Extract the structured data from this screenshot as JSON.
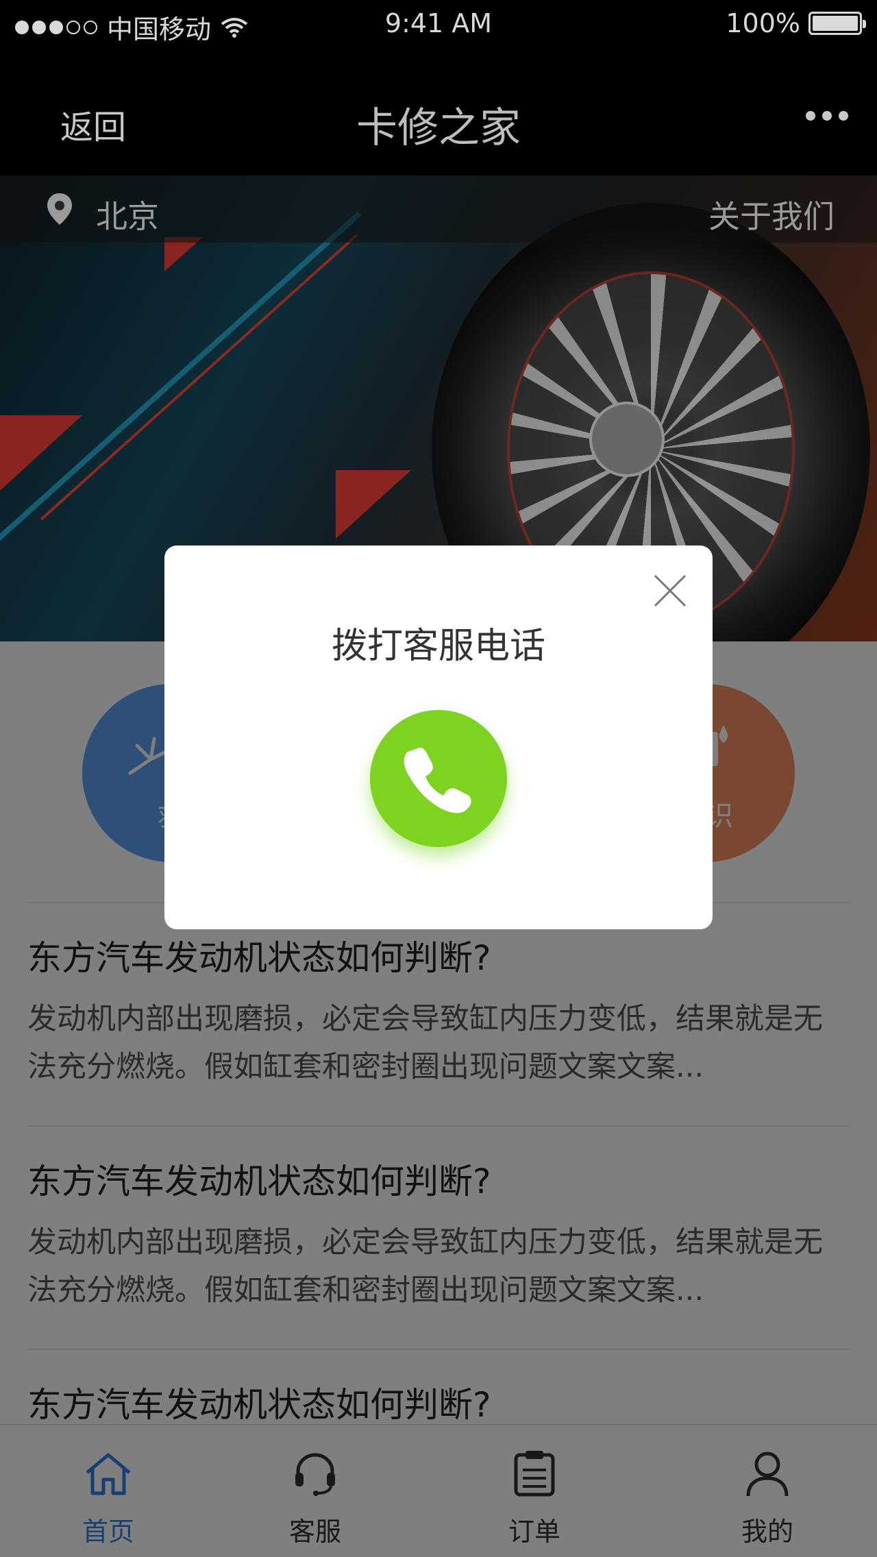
{
  "status_bar": {
    "carrier": "中国移动",
    "time": "9:41 AM",
    "battery": "100%"
  },
  "nav": {
    "back_label": "返回",
    "title": "卡修之家"
  },
  "banner": {
    "city": "北京",
    "about_label": "关于我们"
  },
  "shortcuts": [
    {
      "label": "救",
      "color": "#5d9ff0"
    },
    {
      "label": "知识",
      "color": "#f59160"
    }
  ],
  "articles": [
    {
      "title": "东方汽车发动机状态如何判断?",
      "body": "发动机内部出现磨损，必定会导致缸内压力变低，结果就是无法充分燃烧。假如缸套和密封圈出现问题文案文案..."
    },
    {
      "title": "东方汽车发动机状态如何判断?",
      "body": "发动机内部出现磨损，必定会导致缸内压力变低，结果就是无法充分燃烧。假如缸套和密封圈出现问题文案文案..."
    },
    {
      "title": "东方汽车发动机状态如何判断?",
      "body": ""
    }
  ],
  "tabs": [
    {
      "label": "首页",
      "icon": "home-icon",
      "active": true
    },
    {
      "label": "客服",
      "icon": "headset-icon",
      "active": false
    },
    {
      "label": "订单",
      "icon": "clipboard-icon",
      "active": false
    },
    {
      "label": "我的",
      "icon": "user-icon",
      "active": false
    }
  ],
  "dialog": {
    "title": "拨打客服电话",
    "call_color": "#7ed321"
  },
  "colors": {
    "accent_blue": "#2f7ee3",
    "call_green": "#7ed321"
  }
}
